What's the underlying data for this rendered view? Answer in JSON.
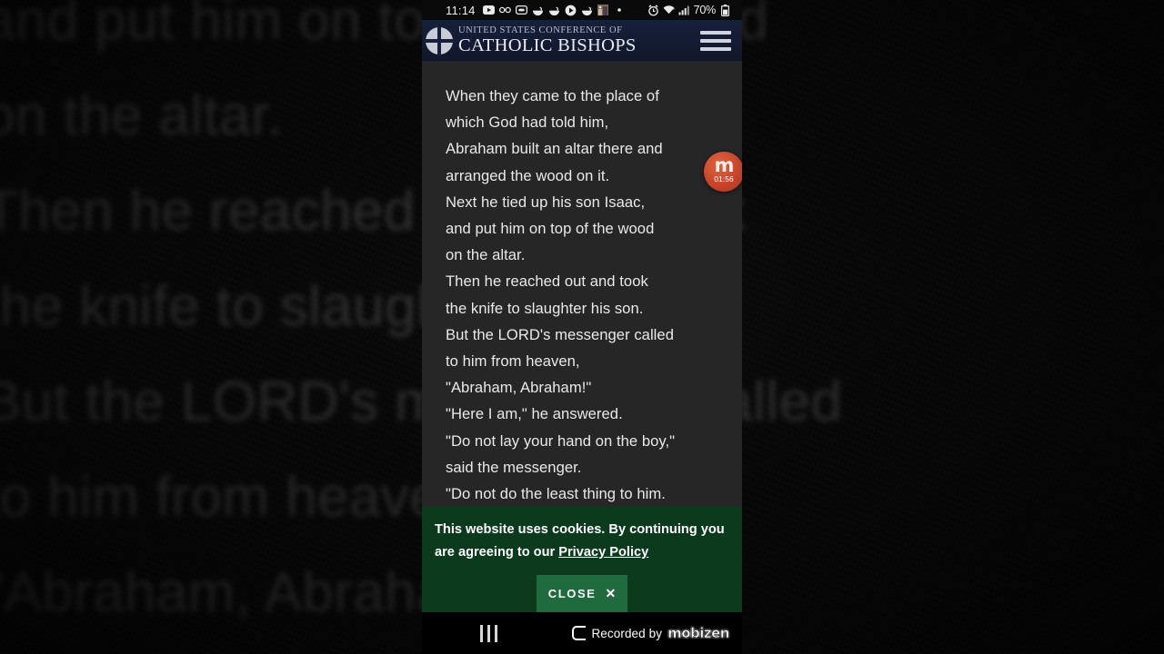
{
  "statusbar": {
    "clock": "11:14",
    "left_icons": [
      "youtube-icon",
      "voicemail-icon",
      "sim-card-icon",
      "app-icon-1",
      "app-icon-2",
      "play-icon",
      "app-icon-3",
      "gallery-icon",
      "dot-icon"
    ],
    "right_icons": [
      "alarm-icon",
      "wifi-icon",
      "signal-icon"
    ],
    "battery": "70%"
  },
  "header": {
    "logo": "usccb-cross-circle-logo",
    "brand_top": "UNITED STATES CONFERENCE OF",
    "brand_main": "CATHOLIC BISHOPS",
    "menu": "hamburger-menu-icon"
  },
  "reading": {
    "lines": [
      "When they came to the place of",
      "which God had told him,",
      "Abraham built an altar there and",
      "arranged the wood on it.",
      "Next he tied up his son Isaac,",
      "and put him on top of the wood",
      "on the altar.",
      "Then he reached out and took",
      "the knife to slaughter his son.",
      "But the LORD's messenger called",
      "to him from heaven,",
      "\"Abraham, Abraham!\"",
      "\"Here I am,\" he answered.",
      "\"Do not lay your hand on the boy,\"",
      "said the messenger.",
      "\"Do not do the least thing to him."
    ]
  },
  "background": {
    "lines": [
      "and put him on top of the wood",
      "on the altar.",
      "Then he reached out and took",
      "the knife to slaughter his son.",
      "But the LORD's messenger called",
      "to him from heaven,",
      "\"Abraham, Abraham!\""
    ]
  },
  "recorder": {
    "logo_letter": "m",
    "timer": "01:56"
  },
  "cookie": {
    "message_part1": "This website uses cookies. By continuing you are agreeing to our ",
    "privacy_link": "Privacy Policy",
    "close_label": "CLOSE",
    "close_x": "✕",
    "banner_color": "#0b3b1c",
    "button_color": "#1f6b3d"
  },
  "navbar": {
    "recents": "recents-button",
    "watermark_text": "Recorded by",
    "watermark_brand": "mobizen"
  }
}
